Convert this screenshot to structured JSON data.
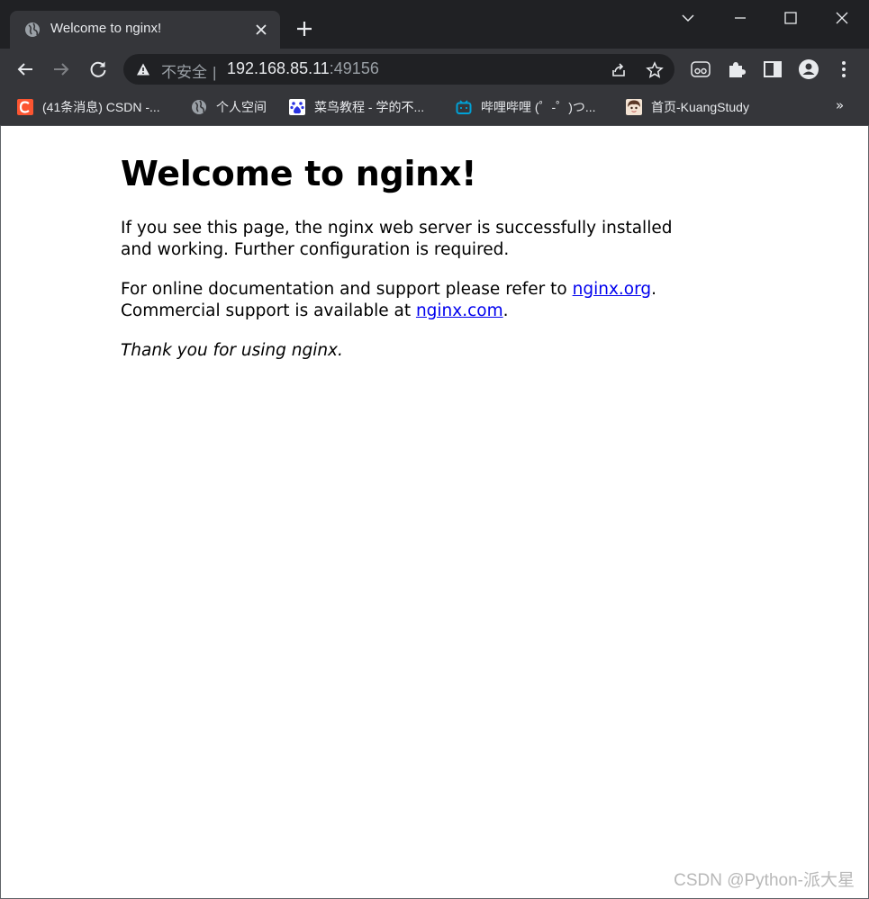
{
  "browser": {
    "tab": {
      "title": "Welcome to nginx!",
      "favicon": "globe-icon"
    },
    "address_bar": {
      "security_label": "不安全",
      "separator": "|",
      "host": "192.168.85.11",
      "port": ":49156"
    },
    "bookmarks": [
      {
        "label": "(41条消息) CSDN -...",
        "icon": "csdn-icon"
      },
      {
        "label": "个人空间",
        "icon": "globe-icon"
      },
      {
        "label": "菜鸟教程 - 学的不...",
        "icon": "baidu-paw-icon"
      },
      {
        "label": "哔哩哔哩 (゜-゜)つ...",
        "icon": "bilibili-icon"
      },
      {
        "label": "首页-KuangStudy",
        "icon": "avatar-icon"
      }
    ],
    "bookmarks_overflow": "»"
  },
  "page": {
    "heading": "Welcome to nginx!",
    "p1": "If you see this page, the nginx web server is successfully installed and working. Further configuration is required.",
    "p2_before": "For online documentation and support please refer to ",
    "link_org": "nginx.org",
    "p2_middle": ".",
    "p2_line2": "Commercial support is available at ",
    "link_com": "nginx.com",
    "p2_end": ".",
    "p3": "Thank you for using nginx."
  },
  "watermark": "CSDN @Python-派大星",
  "colors": {
    "chrome_dark": "#202124",
    "chrome_toolbar": "#35363a",
    "link": "#0000ee",
    "csdn_red": "#fc5531",
    "bilibili_blue": "#00a1d6"
  }
}
